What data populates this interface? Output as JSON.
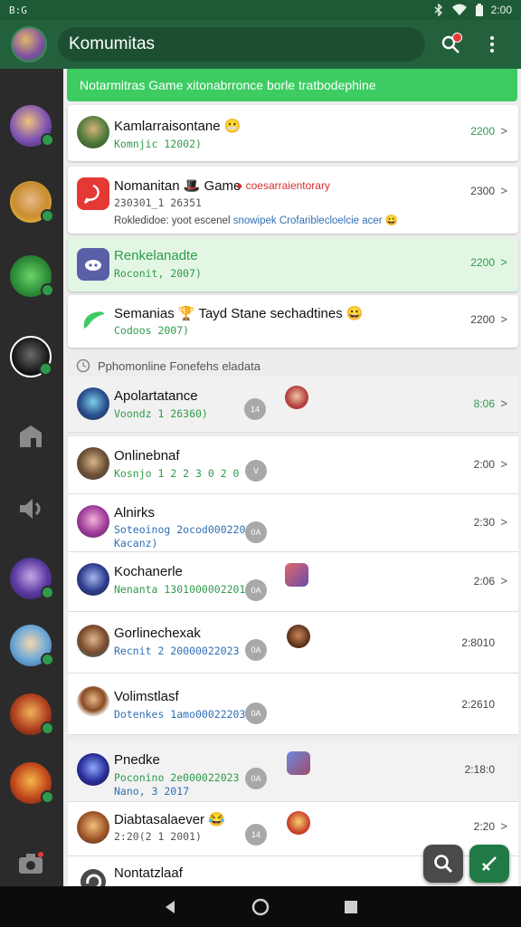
{
  "status_bar": {
    "left_text": "B:G",
    "time": "2:00"
  },
  "app_bar": {
    "title": "Komumitas"
  },
  "banner": {
    "text": "Notarmitras Game  xitonabrronce borle tratbodephine"
  },
  "sidebar": {
    "items": [
      {
        "name": "sidebar-avatar-1",
        "kind": "avatar"
      },
      {
        "name": "sidebar-avatar-2",
        "kind": "avatar"
      },
      {
        "name": "sidebar-avatar-3",
        "kind": "avatar"
      },
      {
        "name": "sidebar-avatar-4",
        "kind": "avatar"
      },
      {
        "name": "sidebar-shop-icon",
        "kind": "icon"
      },
      {
        "name": "sidebar-volume-icon",
        "kind": "icon"
      },
      {
        "name": "sidebar-avatar-5",
        "kind": "avatar"
      },
      {
        "name": "sidebar-avatar-6",
        "kind": "avatar"
      },
      {
        "name": "sidebar-avatar-7",
        "kind": "avatar"
      },
      {
        "name": "sidebar-avatar-8",
        "kind": "avatar"
      }
    ]
  },
  "cards": [
    {
      "name": "Kamlarraisontane 😬",
      "sub": "Komnjic 12002)",
      "time": "2200"
    },
    {
      "name": "Nomanitan 🎩 Game",
      "tag": "coesarraientorary",
      "sub": "230301_1 26351",
      "msg": "Rokledidoe: yoot escenel",
      "msg_link": "snowipek Crofariblecloelcie acer 😀",
      "time": "2300"
    },
    {
      "name": "Renkelanadte",
      "sub": "Roconit, 2007)",
      "time": "2200"
    },
    {
      "name": "Semanias 🏆 Tayd Stane sechadtines 😀",
      "sub": "Codoos 2007)",
      "time": "2200"
    }
  ],
  "section": {
    "label": "Pphomonline  Fonefehs eladata"
  },
  "list": [
    {
      "name": "Apolartatance",
      "sub": "Voondz 1 26360)",
      "sub2": "",
      "time": "8:06",
      "count": "14"
    },
    {
      "name": "Onlinebnaf",
      "sub": "Kosnjo 1 2 2 3 0 2 0",
      "sub2": "",
      "time": "2:00",
      "count": "V"
    },
    {
      "name": "Alnirks",
      "sub": "Soteoinog 2ocod00022003",
      "sub2": "Kacanz)",
      "time": "2:30",
      "count": "0A"
    },
    {
      "name": "Kochanerle",
      "sub": "Nenanta 13010000022011",
      "sub2": "",
      "time": "2:06",
      "count": "0A"
    },
    {
      "name": "Gorlinechexak",
      "sub": "Recnit 2 20000022023",
      "sub2": "",
      "time": "2:8010",
      "count": "0A"
    },
    {
      "name": "Volimstlasf",
      "sub": "Dotenkes 1amo00022203",
      "sub2": "",
      "time": "2:2610",
      "count": "0A"
    },
    {
      "name": "Pnedke",
      "sub": "Poconino 2e000022023",
      "sub2": "Nano, 3 2017",
      "time": "2:18:0",
      "count": "0A"
    },
    {
      "name": "Diabtasalaever 😂",
      "sub": "2:20(2 1 2001)",
      "sub2": "",
      "time": "2:20",
      "count": "14"
    },
    {
      "name": "Nontatzlaaf",
      "sub": "",
      "sub2": "",
      "time": "",
      "count": ""
    }
  ],
  "colors": {
    "primary": "#23613c",
    "accent_green": "#3ccc62",
    "status_bar": "#1f5a37",
    "sidebar_bg": "#2b2b2b",
    "content_bg": "#ededed",
    "highlight_card": "#e3f6e4"
  },
  "icons": {
    "search": "search-icon",
    "more": "more-vert-icon",
    "confirm": "check-icon",
    "camera": "camera-icon"
  }
}
